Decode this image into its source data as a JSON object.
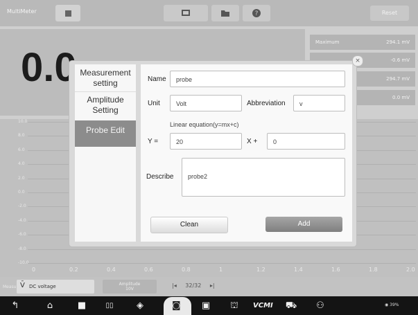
{
  "header": {
    "title": "MultiMeter",
    "reset_label": "Reset"
  },
  "reading": {
    "value": "0.0"
  },
  "stats": [
    {
      "label": "Maximum",
      "value": "294.1 mV"
    },
    {
      "label": "",
      "value": "-0.6 mV"
    },
    {
      "label": "",
      "value": "294.7 mV"
    },
    {
      "label": "",
      "value": "0.0 mV"
    }
  ],
  "graph": {
    "y_ticks": [
      "10.0",
      "8.0",
      "6.0",
      "4.0",
      "2.0",
      "0.0",
      "-2.0",
      "-4.0",
      "-6.0",
      "-8.0",
      "-10.0"
    ],
    "x_ticks": [
      "0",
      "0.2",
      "0.4",
      "0.6",
      "0.8",
      "1",
      "1.2",
      "1.4",
      "1.6",
      "1.8",
      "2.0"
    ]
  },
  "controls": {
    "measure_label": "Measure",
    "measure_value": "DC voltage",
    "amplitude_label": "Amplitude",
    "amplitude_value": "10V",
    "page": "32/32"
  },
  "dialog": {
    "tabs": [
      {
        "label": "Measurement setting"
      },
      {
        "label": "Amplitude Setting"
      },
      {
        "label": "Probe Edit"
      }
    ],
    "name_label": "Name",
    "name_value": "probe",
    "unit_label": "Unit",
    "unit_value": "Volt",
    "abbr_label": "Abbreviation",
    "abbr_value": "v",
    "equation_label": "Linear equation(y=mx+c)",
    "y_label": "Y  =",
    "m_value": "20",
    "x_label": "X  +",
    "c_value": "0",
    "describe_label": "Describe",
    "describe_value": "probe2",
    "clean_label": "Clean",
    "add_label": "Add"
  },
  "statusbar": {
    "text": "39%"
  },
  "colors": {
    "accent_button": "#8e8e8e",
    "active_tab": "#8c8c8c"
  }
}
